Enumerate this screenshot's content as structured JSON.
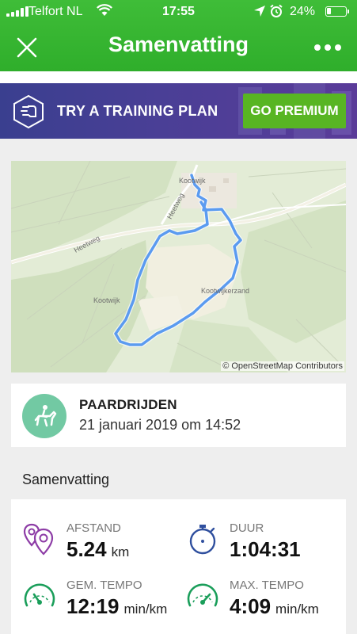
{
  "status_bar": {
    "carrier": "Telfort NL",
    "time": "17:55",
    "battery": "24%",
    "battery_level": 0.24
  },
  "nav": {
    "title": "Samenvatting",
    "close_icon": "close-icon",
    "more_icon": "more-dots-icon"
  },
  "banner": {
    "text": "TRY A TRAINING PLAN",
    "button": "GO PREMIUM",
    "icon": "training-plan-icon",
    "colors": {
      "button": "#58b523",
      "background": "#4a3f96"
    }
  },
  "map": {
    "labels": {
      "kootwijk_top": "Kootwijk",
      "heetweg": "Heetweg",
      "heetweg2": "Heetweg",
      "kootwijk_left": "Kootwijk",
      "kootwijkerzand": "Kootwijkerzand"
    },
    "attribution": "© OpenStreetMap Contributors",
    "route_color": "#5b9bf0"
  },
  "activity": {
    "name": "PAARDRIJDEN",
    "date": "21 januari 2019 om 14:52",
    "icon": "horse-riding-icon",
    "icon_color": "#72c9a3"
  },
  "summary": {
    "title": "Samenvatting",
    "stats": [
      {
        "label": "AFSTAND",
        "value": "5.24",
        "unit": "km",
        "icon": "distance-pins-icon"
      },
      {
        "label": "DUUR",
        "value": "1:04:31",
        "unit": "",
        "icon": "stopwatch-icon"
      },
      {
        "label": "GEM. TEMPO",
        "value": "12:19",
        "unit": "min/km",
        "icon": "speedometer-icon"
      },
      {
        "label": "MAX. TEMPO",
        "value": "4:09",
        "unit": "min/km",
        "icon": "speedometer-icon"
      }
    ]
  }
}
